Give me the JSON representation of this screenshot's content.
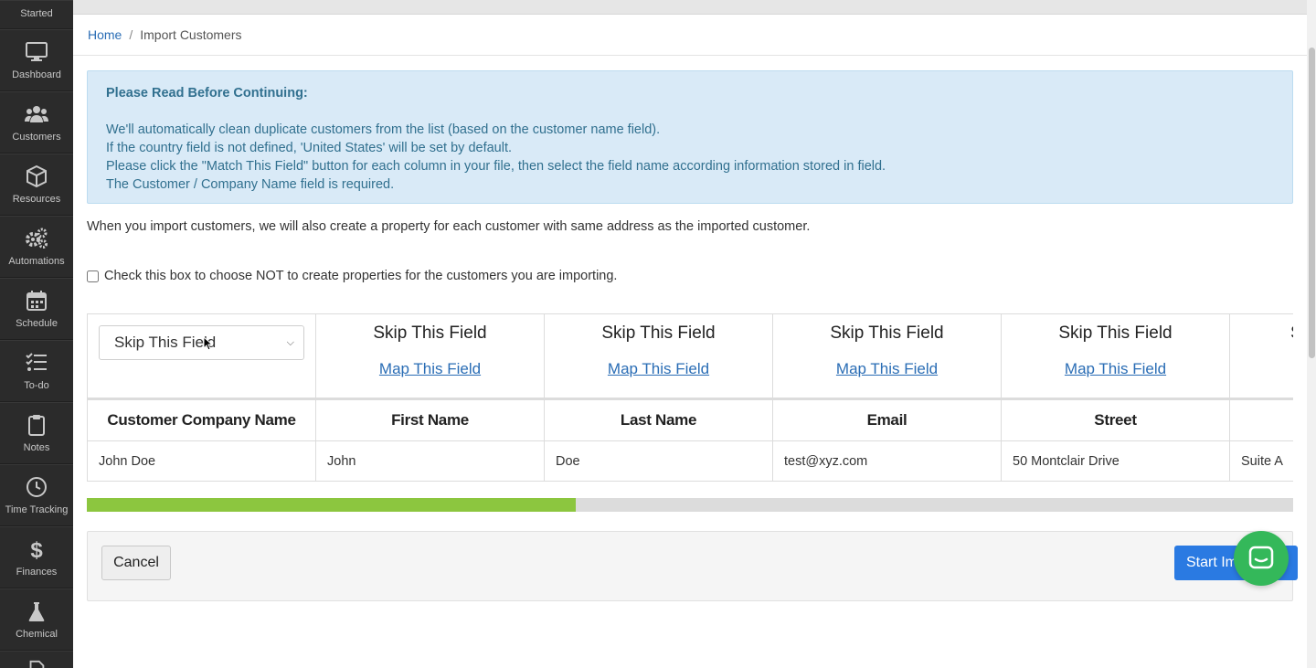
{
  "sidebar": {
    "items": [
      {
        "label": "Started",
        "icon": "started-icon"
      },
      {
        "label": "Dashboard",
        "icon": "monitor-icon"
      },
      {
        "label": "Customers",
        "icon": "users-icon"
      },
      {
        "label": "Resources",
        "icon": "box-icon"
      },
      {
        "label": "Automations",
        "icon": "gears-icon"
      },
      {
        "label": "Schedule",
        "icon": "calendar-icon"
      },
      {
        "label": "To-do",
        "icon": "checklist-icon"
      },
      {
        "label": "Notes",
        "icon": "clipboard-icon"
      },
      {
        "label": "Time Tracking",
        "icon": "clock-icon"
      },
      {
        "label": "Finances",
        "icon": "dollar-icon"
      },
      {
        "label": "Chemical",
        "icon": "flask-icon"
      }
    ]
  },
  "breadcrumb": {
    "home": "Home",
    "separator": "/",
    "current": "Import Customers"
  },
  "alert": {
    "title": "Please Read Before Continuing:",
    "lines": [
      "We'll automatically clean duplicate customers from the list (based on the customer name field).",
      "If the country field is not defined, 'United States' will be set by default.",
      "Please click the \"Match This Field\" button for each column in your file, then select the field name according information stored in field.",
      "The Customer / Company Name field is required."
    ]
  },
  "note": "When you import customers, we will also create a property for each customer with same address as the imported customer.",
  "checkbox_label": "Check this box to choose NOT to create properties for the customers you are importing.",
  "mapping": {
    "select_value": "Skip This Field",
    "skip_label": "Skip This Field",
    "map_link": "Map This Field",
    "partial_label": "S"
  },
  "table": {
    "headers": [
      "Customer Company Name",
      "First Name",
      "Last Name",
      "Email",
      "Street",
      ""
    ],
    "row": [
      "John Doe",
      "John",
      "Doe",
      "test@xyz.com",
      "50 Montclair Drive",
      "Suite A"
    ]
  },
  "progress": {
    "value": 0.405
  },
  "footer": {
    "cancel": "Cancel",
    "start": "Start Im"
  },
  "colors": {
    "accent": "#2a7ae2",
    "progress": "#8cc63f",
    "alert_bg": "#d9eaf7",
    "chat": "#34b85a"
  }
}
